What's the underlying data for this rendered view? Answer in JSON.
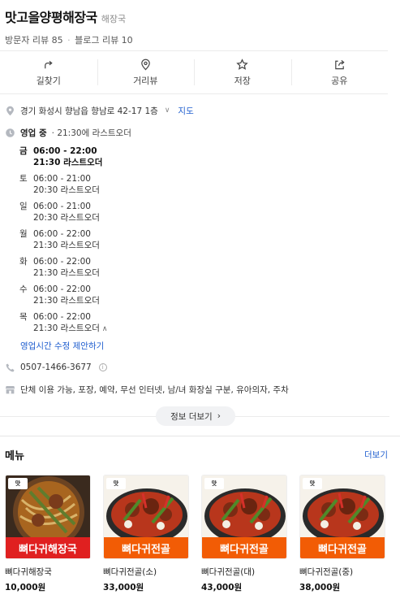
{
  "place": {
    "name": "맛고을양평해장국",
    "category": "해장국",
    "visitor_reviews": "방문자 리뷰 85",
    "separator": "·",
    "blog_reviews": "블로그 리뷰 10"
  },
  "actions": [
    {
      "label": "길찾기",
      "icon": "directions-icon"
    },
    {
      "label": "거리뷰",
      "icon": "location-pin-icon"
    },
    {
      "label": "저장",
      "icon": "star-icon"
    },
    {
      "label": "공유",
      "icon": "share-icon"
    }
  ],
  "address": {
    "text": "경기 화성시 향남읍 향남로 42-17 1층",
    "map_link": "지도"
  },
  "hours": {
    "status": "영업 중",
    "last_order_note": "· 21:30에 라스트오더",
    "days": [
      {
        "day": "금",
        "time": "06:00 - 22:00",
        "last_order": "21:30 라스트오더",
        "today": true
      },
      {
        "day": "토",
        "time": "06:00 - 21:00",
        "last_order": "20:30 라스트오더"
      },
      {
        "day": "일",
        "time": "06:00 - 21:00",
        "last_order": "20:30 라스트오더"
      },
      {
        "day": "월",
        "time": "06:00 - 22:00",
        "last_order": "21:30 라스트오더"
      },
      {
        "day": "화",
        "time": "06:00 - 22:00",
        "last_order": "21:30 라스트오더"
      },
      {
        "day": "수",
        "time": "06:00 - 22:00",
        "last_order": "21:30 라스트오더"
      },
      {
        "day": "목",
        "time": "06:00 - 22:00",
        "last_order": "21:30 라스트오더"
      }
    ],
    "suggest_edit": "영업시간 수정 제안하기"
  },
  "phone": "0507-1466-3677",
  "facilities": "단체 이용 가능, 포장, 예약, 무선 인터넷, 남/녀 화장실 구분, 유아의자, 주차",
  "more_info_label": "정보 더보기",
  "menu": {
    "title": "메뉴",
    "more": "더보기",
    "items": [
      {
        "name": "뼈다귀해장국",
        "price": "10,000원",
        "banner": "뼈다귀해장국",
        "banner_color": "#e02020"
      },
      {
        "name": "뼈다귀전골(소)",
        "price": "33,000원",
        "banner": "뼈다귀전골",
        "banner_color": "#f25c05"
      },
      {
        "name": "뼈다귀전골(대)",
        "price": "43,000원",
        "banner": "뼈다귀전골",
        "banner_color": "#f25c05"
      },
      {
        "name": "뼈다귀전골(중)",
        "price": "38,000원",
        "banner": "뼈다귀전골",
        "banner_color": "#f25c05"
      }
    ]
  },
  "colors": {
    "link": "#1f5ecf",
    "banner_red": "#e02020",
    "banner_orange": "#f25c05"
  }
}
